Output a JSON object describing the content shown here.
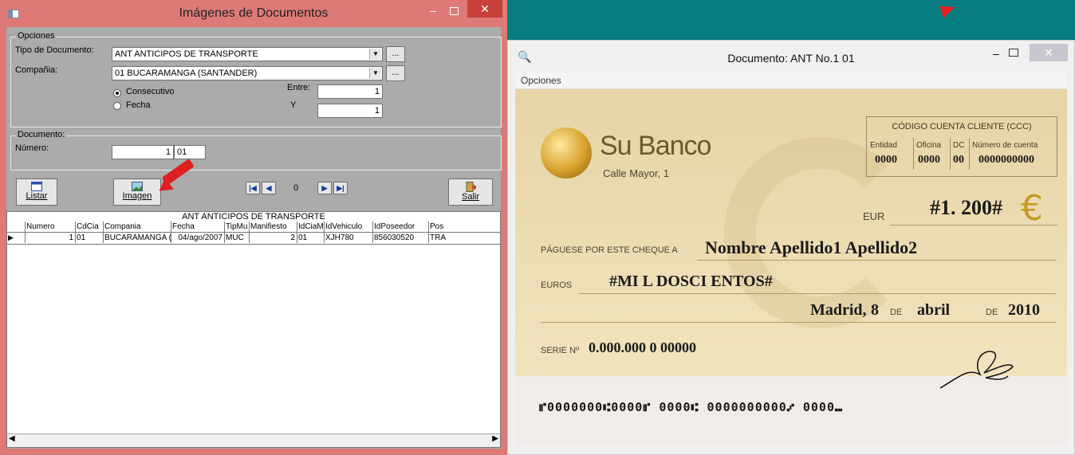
{
  "win1": {
    "title": "Imágenes de Documentos",
    "options": {
      "group_title": "Opciones",
      "tipo_label": "Tipo de Documento:",
      "tipo_value": "ANT  ANTICIPOS DE TRANSPORTE",
      "compania_label": "Compañia:",
      "compania_value": "01 BUCARAMANGA  (SANTANDER)",
      "radio_consecutivo": "Consecutivo",
      "radio_fecha": "Fecha",
      "entre_label": "Entre:",
      "entre_value": "1",
      "y_label": "Y",
      "y_value": "1",
      "dots": "..."
    },
    "documento": {
      "group_title": "Documento:",
      "numero_label": "Número:",
      "numero_value": "1",
      "numero_suffix": "01"
    },
    "buttons": {
      "listar": "Listar",
      "imagen": "Imagen",
      "salir": "Salir",
      "nav_counter": "0"
    },
    "grid": {
      "caption": "ANT  ANTICIPOS DE TRANSPORTE",
      "columns": [
        "Numero",
        "CdCia",
        "Compania",
        "Fecha",
        "TipMu",
        "Manifiesto",
        "IdCiaM",
        "IdVehiculo",
        "IdPoseedor",
        "Pos"
      ],
      "rows": [
        [
          "1",
          "01",
          "BUCARAMANGA  (SA",
          "04/ago/2007",
          "MUC",
          "2",
          "01",
          "XJH780",
          "856030520",
          "TRA"
        ]
      ]
    }
  },
  "win2": {
    "title": "Documento: ANT No.1 01",
    "menu": "Opciones",
    "cheque": {
      "bank_name": "Su Banco",
      "bank_address": "Calle Mayor, 1",
      "ccc_title": "CÓDIGO CUENTA CLIENTE (CCC)",
      "ccc_headers": [
        "Entidad",
        "Oficina",
        "DC",
        "Número de cuenta"
      ],
      "ccc_values": [
        "0000",
        "0000",
        "00",
        "0000000000"
      ],
      "currency": "EUR",
      "amount": "#1. 200#",
      "euro_symbol": "€",
      "payee_label": "PÁGUESE POR ESTE CHEQUE A",
      "payee": "Nombre Apellido1 Apellido2",
      "euros_label": "EUROS",
      "amount_words": "#MI L DOSCI ENTOS#",
      "place": "Madrid,",
      "day": "8",
      "de1": "DE",
      "month": "abril",
      "de2": "DE",
      "year": "2010",
      "serie_label": "SERIE Nº",
      "serie": "0.000.000 0 00000",
      "micr": "⑈0000000⑆0000⑈ 0000⑆ 0000000000⑇ 0000⑉"
    }
  }
}
